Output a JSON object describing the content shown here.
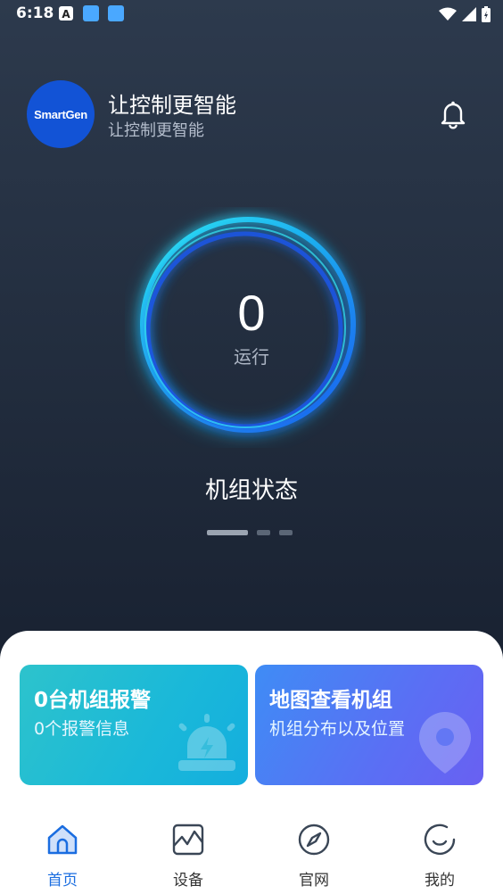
{
  "status_bar": {
    "time": "6:18",
    "notif_letter": "A"
  },
  "header": {
    "logo_text": "SmartGen",
    "title": "让控制更智能",
    "subtitle": "让控制更智能"
  },
  "status_ring": {
    "count": "0",
    "label": "运行"
  },
  "section_title": "机组状态",
  "carousel": {
    "page_count": 3,
    "active_index": 0
  },
  "cards": [
    {
      "title": "0台机组报警",
      "subtitle": "0个报警信息",
      "icon": "alarm-light-icon"
    },
    {
      "title": "地图查看机组",
      "subtitle": "机组分布以及位置",
      "icon": "map-pin-icon"
    }
  ],
  "nav": {
    "items": [
      {
        "label": "首页",
        "icon": "home-icon",
        "active": true
      },
      {
        "label": "设备",
        "icon": "device-chart-icon",
        "active": false
      },
      {
        "label": "官网",
        "icon": "compass-icon",
        "active": false
      },
      {
        "label": "我的",
        "icon": "smile-icon",
        "active": false
      }
    ]
  },
  "colors": {
    "accent": "#1a6de0",
    "ring_cyan": "#22e0f0",
    "ring_blue": "#1d5df0",
    "alarm_card": "#1fbcd6",
    "map_card": "#5a72f4"
  }
}
